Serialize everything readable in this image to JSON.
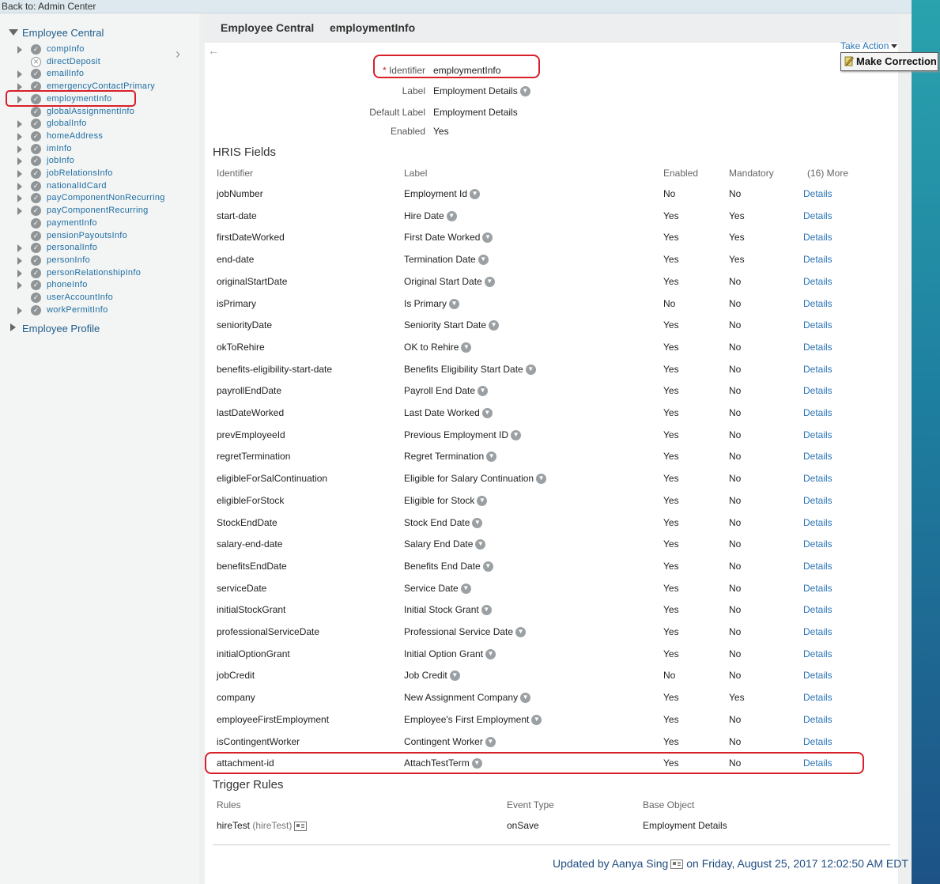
{
  "topbar": {
    "back_label": "Back to: Admin Center"
  },
  "sidebar": {
    "root_ec": "Employee Central",
    "root_ep": "Employee Profile",
    "items": [
      {
        "label": "compInfo",
        "expandable": true,
        "status": "check"
      },
      {
        "label": "directDeposit",
        "expandable": false,
        "status": "x"
      },
      {
        "label": "emailInfo",
        "expandable": true,
        "status": "check"
      },
      {
        "label": "emergencyContactPrimary",
        "expandable": true,
        "status": "check"
      },
      {
        "label": "employmentInfo",
        "expandable": true,
        "status": "check"
      },
      {
        "label": "globalAssignmentInfo",
        "expandable": false,
        "status": "check"
      },
      {
        "label": "globalInfo",
        "expandable": true,
        "status": "check"
      },
      {
        "label": "homeAddress",
        "expandable": true,
        "status": "check"
      },
      {
        "label": "imInfo",
        "expandable": true,
        "status": "check"
      },
      {
        "label": "jobInfo",
        "expandable": true,
        "status": "check"
      },
      {
        "label": "jobRelationsInfo",
        "expandable": true,
        "status": "check"
      },
      {
        "label": "nationalIdCard",
        "expandable": true,
        "status": "check"
      },
      {
        "label": "payComponentNonRecurring",
        "expandable": true,
        "status": "check"
      },
      {
        "label": "payComponentRecurring",
        "expandable": true,
        "status": "check"
      },
      {
        "label": "paymentInfo",
        "expandable": false,
        "status": "check"
      },
      {
        "label": "pensionPayoutsInfo",
        "expandable": false,
        "status": "check"
      },
      {
        "label": "personalInfo",
        "expandable": true,
        "status": "check"
      },
      {
        "label": "personInfo",
        "expandable": true,
        "status": "check"
      },
      {
        "label": "personRelationshipInfo",
        "expandable": true,
        "status": "check"
      },
      {
        "label": "phoneInfo",
        "expandable": true,
        "status": "check"
      },
      {
        "label": "userAccountInfo",
        "expandable": false,
        "status": "check"
      },
      {
        "label": "workPermitInfo",
        "expandable": true,
        "status": "check"
      }
    ]
  },
  "header": {
    "title1": "Employee Central",
    "title2": "employmentInfo"
  },
  "actions": {
    "take_action": "Take Action",
    "make_correction": "Make Correction"
  },
  "props": {
    "identifier_label": "Identifier",
    "identifier_value": "employmentInfo",
    "label_label": "Label",
    "label_value": "Employment Details",
    "default_label_label": "Default Label",
    "default_label_value": "Employment Details",
    "enabled_label": "Enabled",
    "enabled_value": "Yes"
  },
  "hris": {
    "title": "HRIS Fields",
    "headers": {
      "identifier": "Identifier",
      "label": "Label",
      "enabled": "Enabled",
      "mandatory": "Mandatory",
      "more": "(16) More"
    },
    "rows": [
      {
        "id": "jobNumber",
        "label": "Employment Id",
        "enabled": "No",
        "mandatory": "No",
        "link": "Details"
      },
      {
        "id": "start-date",
        "label": "Hire Date",
        "enabled": "Yes",
        "mandatory": "Yes",
        "link": "Details"
      },
      {
        "id": "firstDateWorked",
        "label": "First Date Worked",
        "enabled": "Yes",
        "mandatory": "Yes",
        "link": "Details"
      },
      {
        "id": "end-date",
        "label": "Termination Date",
        "enabled": "Yes",
        "mandatory": "Yes",
        "link": "Details"
      },
      {
        "id": "originalStartDate",
        "label": "Original Start Date",
        "enabled": "Yes",
        "mandatory": "No",
        "link": "Details"
      },
      {
        "id": "isPrimary",
        "label": "Is Primary",
        "enabled": "No",
        "mandatory": "No",
        "link": "Details"
      },
      {
        "id": "seniorityDate",
        "label": "Seniority Start Date",
        "enabled": "Yes",
        "mandatory": "No",
        "link": "Details"
      },
      {
        "id": "okToRehire",
        "label": "OK to Rehire",
        "enabled": "Yes",
        "mandatory": "No",
        "link": "Details"
      },
      {
        "id": "benefits-eligibility-start-date",
        "label": "Benefits Eligibility Start Date",
        "enabled": "Yes",
        "mandatory": "No",
        "link": "Details"
      },
      {
        "id": "payrollEndDate",
        "label": "Payroll End Date",
        "enabled": "Yes",
        "mandatory": "No",
        "link": "Details"
      },
      {
        "id": "lastDateWorked",
        "label": "Last Date Worked",
        "enabled": "Yes",
        "mandatory": "No",
        "link": "Details"
      },
      {
        "id": "prevEmployeeId",
        "label": "Previous Employment ID",
        "enabled": "Yes",
        "mandatory": "No",
        "link": "Details"
      },
      {
        "id": "regretTermination",
        "label": "Regret Termination",
        "enabled": "Yes",
        "mandatory": "No",
        "link": "Details"
      },
      {
        "id": "eligibleForSalContinuation",
        "label": "Eligible for Salary Continuation",
        "enabled": "Yes",
        "mandatory": "No",
        "link": "Details"
      },
      {
        "id": "eligibleForStock",
        "label": "Eligible for Stock",
        "enabled": "Yes",
        "mandatory": "No",
        "link": "Details"
      },
      {
        "id": "StockEndDate",
        "label": "Stock End Date",
        "enabled": "Yes",
        "mandatory": "No",
        "link": "Details"
      },
      {
        "id": "salary-end-date",
        "label": "Salary End Date",
        "enabled": "Yes",
        "mandatory": "No",
        "link": "Details"
      },
      {
        "id": "benefitsEndDate",
        "label": "Benefits End Date",
        "enabled": "Yes",
        "mandatory": "No",
        "link": "Details"
      },
      {
        "id": "serviceDate",
        "label": "Service Date",
        "enabled": "Yes",
        "mandatory": "No",
        "link": "Details"
      },
      {
        "id": "initialStockGrant",
        "label": "Initial Stock Grant",
        "enabled": "Yes",
        "mandatory": "No",
        "link": "Details"
      },
      {
        "id": "professionalServiceDate",
        "label": "Professional Service Date",
        "enabled": "Yes",
        "mandatory": "No",
        "link": "Details"
      },
      {
        "id": "initialOptionGrant",
        "label": "Initial Option Grant",
        "enabled": "Yes",
        "mandatory": "No",
        "link": "Details"
      },
      {
        "id": "jobCredit",
        "label": "Job Credit",
        "enabled": "No",
        "mandatory": "No",
        "link": "Details"
      },
      {
        "id": "company",
        "label": "New Assignment Company",
        "enabled": "Yes",
        "mandatory": "Yes",
        "link": "Details"
      },
      {
        "id": "employeeFirstEmployment",
        "label": "Employee's First Employment",
        "enabled": "Yes",
        "mandatory": "No",
        "link": "Details"
      },
      {
        "id": "isContingentWorker",
        "label": "Contingent Worker",
        "enabled": "Yes",
        "mandatory": "No",
        "link": "Details"
      },
      {
        "id": "attachment-id",
        "label": "AttachTestTerm",
        "enabled": "Yes",
        "mandatory": "No",
        "link": "Details"
      }
    ]
  },
  "trigger": {
    "title": "Trigger Rules",
    "headers": {
      "rules": "Rules",
      "event_type": "Event Type",
      "base_object": "Base Object"
    },
    "rows": [
      {
        "rule": "hireTest",
        "rule_id": "(hireTest)",
        "event_type": "onSave",
        "base_object": "Employment Details"
      }
    ]
  },
  "footer": {
    "updated_by": "Updated by Aanya Sing",
    "on_date": "on Friday, August 25, 2017 12:02:50 AM EDT"
  }
}
